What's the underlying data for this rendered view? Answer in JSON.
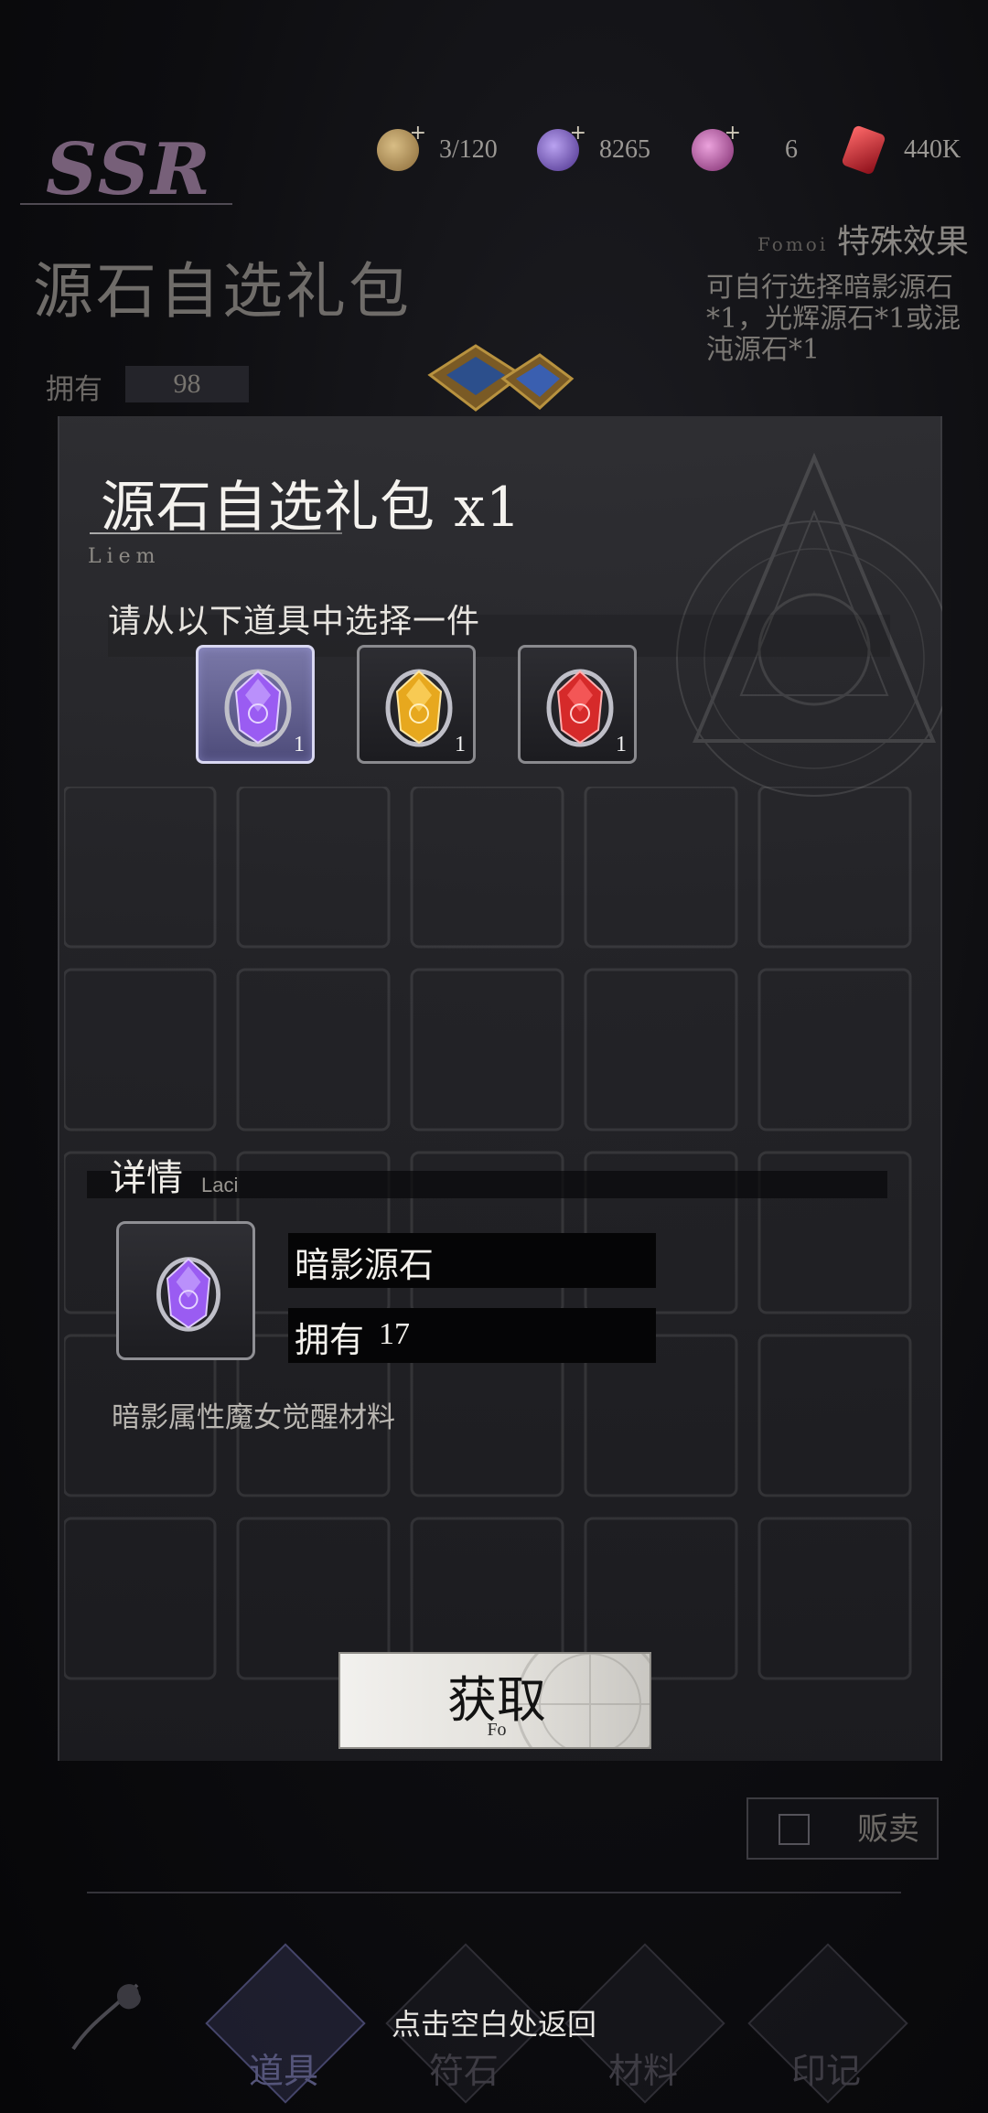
{
  "rarity": "SSR",
  "currencies": [
    {
      "icon": "scroll-icon",
      "value": "3/120",
      "color": "#b99a62"
    },
    {
      "icon": "purple-orb-icon",
      "value": "8265",
      "color": "#7d62c9"
    },
    {
      "icon": "pink-orb-icon",
      "value": "6",
      "color": "#c45fb0"
    },
    {
      "icon": "red-crystal-icon",
      "value": "440K",
      "color": "#c62c36"
    }
  ],
  "background_item": {
    "title": "源石自选礼包",
    "own_label": "拥有",
    "own_value": "98",
    "effect_title": "特殊效果",
    "effect_sub": "Fomoi",
    "effect_desc": "可自行选择暗影源石*1，光辉源石*1或混沌源石*1"
  },
  "modal": {
    "title": "源石自选礼包 x1",
    "title_sub": "Liem",
    "prompt": "请从以下道具中选择一件",
    "options": [
      {
        "icon": "shadow-stone-icon",
        "count": "1",
        "color": "#8c4fe0",
        "selected": true
      },
      {
        "icon": "radiant-stone-icon",
        "count": "1",
        "color": "#e0a81e",
        "selected": false
      },
      {
        "icon": "chaos-stone-icon",
        "count": "1",
        "color": "#d42a2a",
        "selected": false
      }
    ],
    "detail": {
      "title": "详情",
      "sub": "Laci",
      "name": "暗影源石",
      "own_label": "拥有",
      "own_value": "17",
      "description": "暗影属性魔女觉醒材料"
    },
    "get_button": {
      "label": "获取",
      "sub": "Fo"
    }
  },
  "sell": {
    "label": "贩卖"
  },
  "nav": [
    {
      "label": "道具",
      "icon": "item-icon",
      "active": true
    },
    {
      "label": "符石",
      "icon": "rune-icon",
      "active": false
    },
    {
      "label": "材料",
      "icon": "material-icon",
      "active": false
    },
    {
      "label": "印记",
      "icon": "seal-icon",
      "active": false
    }
  ],
  "hint": "点击空白处返回"
}
